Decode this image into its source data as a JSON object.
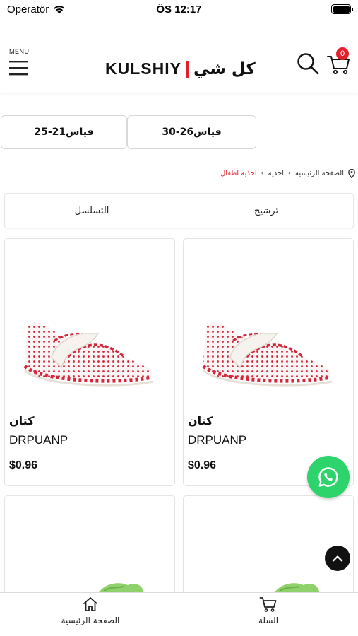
{
  "status_bar": {
    "carrier": "Operatör",
    "time": "ÖS 12:17"
  },
  "header": {
    "menu_label": "MENU",
    "logo_latin": "KULSHIY",
    "logo_arabic": "كل شي",
    "cart_count": "0",
    "accent_color": "#e2202a"
  },
  "size_filters": [
    {
      "label": "قياس21-25"
    },
    {
      "label": "قياس26-30"
    }
  ],
  "breadcrumb": {
    "home": "الصفحة الرئيسية",
    "level1": "احذية",
    "level2": "احذية اطفال"
  },
  "sort_bar": {
    "filter_label": "ترشيح",
    "order_label": "التسلسل"
  },
  "products": [
    {
      "name": "كتان",
      "code": "DRPUANP",
      "price": "$0.96"
    },
    {
      "name": "كتان",
      "code": "DRPUANP",
      "price": "$0.96"
    }
  ],
  "fab": {
    "whatsapp_color": "#2cd46b"
  },
  "bottom_nav": {
    "home_label": "الصفحة الرئيسية",
    "cart_label": "السلة"
  }
}
